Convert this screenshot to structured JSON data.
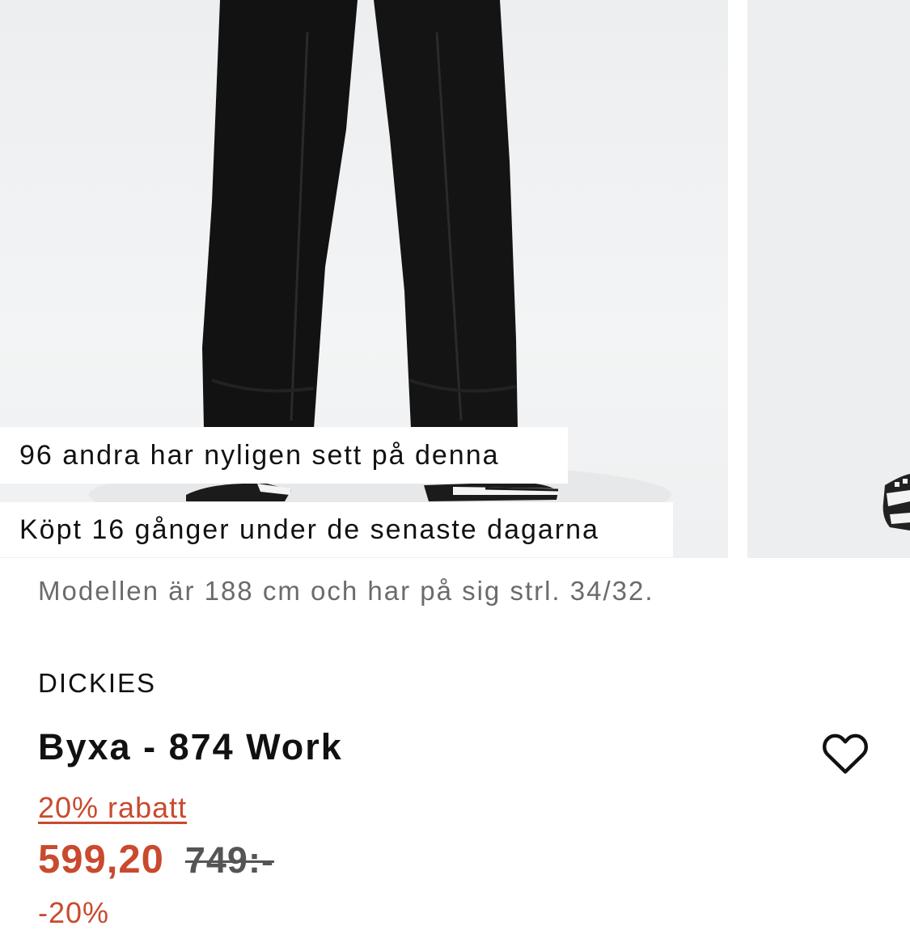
{
  "gallery": {
    "badge_recently_viewed": "96 andra har nyligen sett på denna",
    "badge_bought": "Köpt 16 gånger under de senaste dagarna"
  },
  "product": {
    "model_info": "Modellen är 188 cm och har på sig strl. 34/32.",
    "brand": "DICKIES",
    "title": "Byxa - 874 Work",
    "discount_label": "20% rabatt",
    "price_sale": "599,20",
    "price_original": "749:-",
    "discount_tag": "-20%"
  },
  "icons": {
    "wishlist": "heart-outline-icon"
  },
  "colors": {
    "sale": "#c94a2e",
    "text": "#111111",
    "muted": "#6b6b6b",
    "photo_bg": "#eceef0"
  }
}
